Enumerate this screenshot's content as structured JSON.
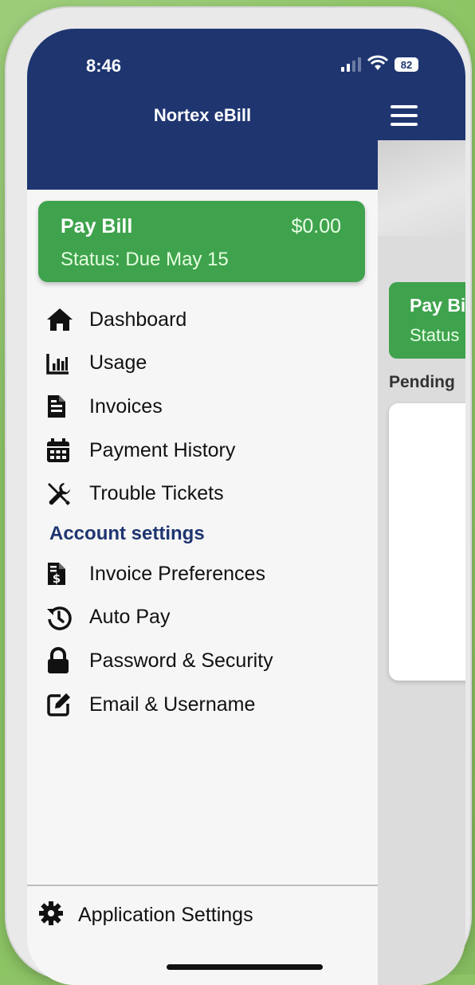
{
  "status_bar": {
    "time": "8:46",
    "battery": "82"
  },
  "header": {
    "title": "Nortex eBill"
  },
  "pay_bill": {
    "label": "Pay Bill",
    "amount": "$0.00",
    "status": "Status: Due May 15"
  },
  "main_behind": {
    "pay_label": "Pay Bi",
    "status_label": "Status",
    "pending_label": "Pending"
  },
  "menu": {
    "items": [
      {
        "label": "Dashboard",
        "icon": "home-icon"
      },
      {
        "label": "Usage",
        "icon": "bar-chart-icon"
      },
      {
        "label": "Invoices",
        "icon": "document-icon"
      },
      {
        "label": "Payment History",
        "icon": "calendar-icon"
      },
      {
        "label": "Trouble Tickets",
        "icon": "tools-icon"
      }
    ],
    "section_label": "Account settings",
    "settings_items": [
      {
        "label": "Invoice Preferences",
        "icon": "invoice-dollar-icon"
      },
      {
        "label": "Auto Pay",
        "icon": "history-clock-icon"
      },
      {
        "label": "Password & Security",
        "icon": "lock-icon"
      },
      {
        "label": "Email & Username",
        "icon": "edit-icon"
      }
    ]
  },
  "footer": {
    "app_settings_label": "Application Settings",
    "icon": "gear-icon"
  },
  "colors": {
    "header": "#1e3570",
    "pay_card": "#3fa34d",
    "section_label": "#1e3570",
    "background": "#8dc565"
  }
}
